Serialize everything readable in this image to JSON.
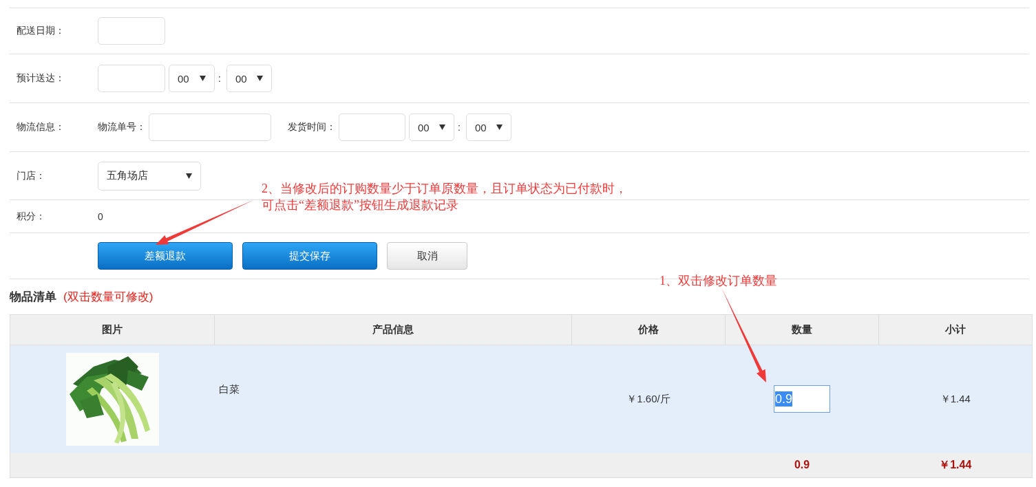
{
  "form": {
    "rows": [
      {
        "kind": "date",
        "label": "配送日期："
      },
      {
        "kind": "datetime",
        "label": "预计送达：",
        "hour": "00",
        "separator": ":",
        "minute": "00"
      },
      {
        "kind": "logistics",
        "label": "物流信息：",
        "tracking_label": "物流单号：",
        "ship_time_label": "发货时间：",
        "hour": "00",
        "separator": ":",
        "minute": "00"
      },
      {
        "kind": "select",
        "label": "门店：",
        "value": "五角场店"
      },
      {
        "kind": "text",
        "label": "积分：",
        "value": "0"
      }
    ],
    "buttons": [
      {
        "label": "差额退款",
        "kind": "primary"
      },
      {
        "label": "提交保存",
        "kind": "primary"
      },
      {
        "label": "取消",
        "kind": "default"
      }
    ]
  },
  "items": {
    "title": "物品清单",
    "hint": "(双击数量可修改)",
    "columns": [
      "图片",
      "产品信息",
      "价格",
      "数量",
      "小计"
    ],
    "rows": [
      {
        "product": "白菜",
        "price": "￥1.60/斤",
        "quantity": "0.9",
        "subtotal": "￥1.44",
        "editing": true
      }
    ],
    "totals": {
      "quantity": "0.9",
      "subtotal": "￥1.44"
    }
  },
  "annotations": [
    {
      "lines": [
        "2、当修改后的订购数量少于订单原数量，且订单状态为已付款时，",
        "可点击“差额退款”按钮生成退款记录"
      ]
    },
    {
      "lines": [
        "1、双击修改订单数量"
      ]
    }
  ]
}
